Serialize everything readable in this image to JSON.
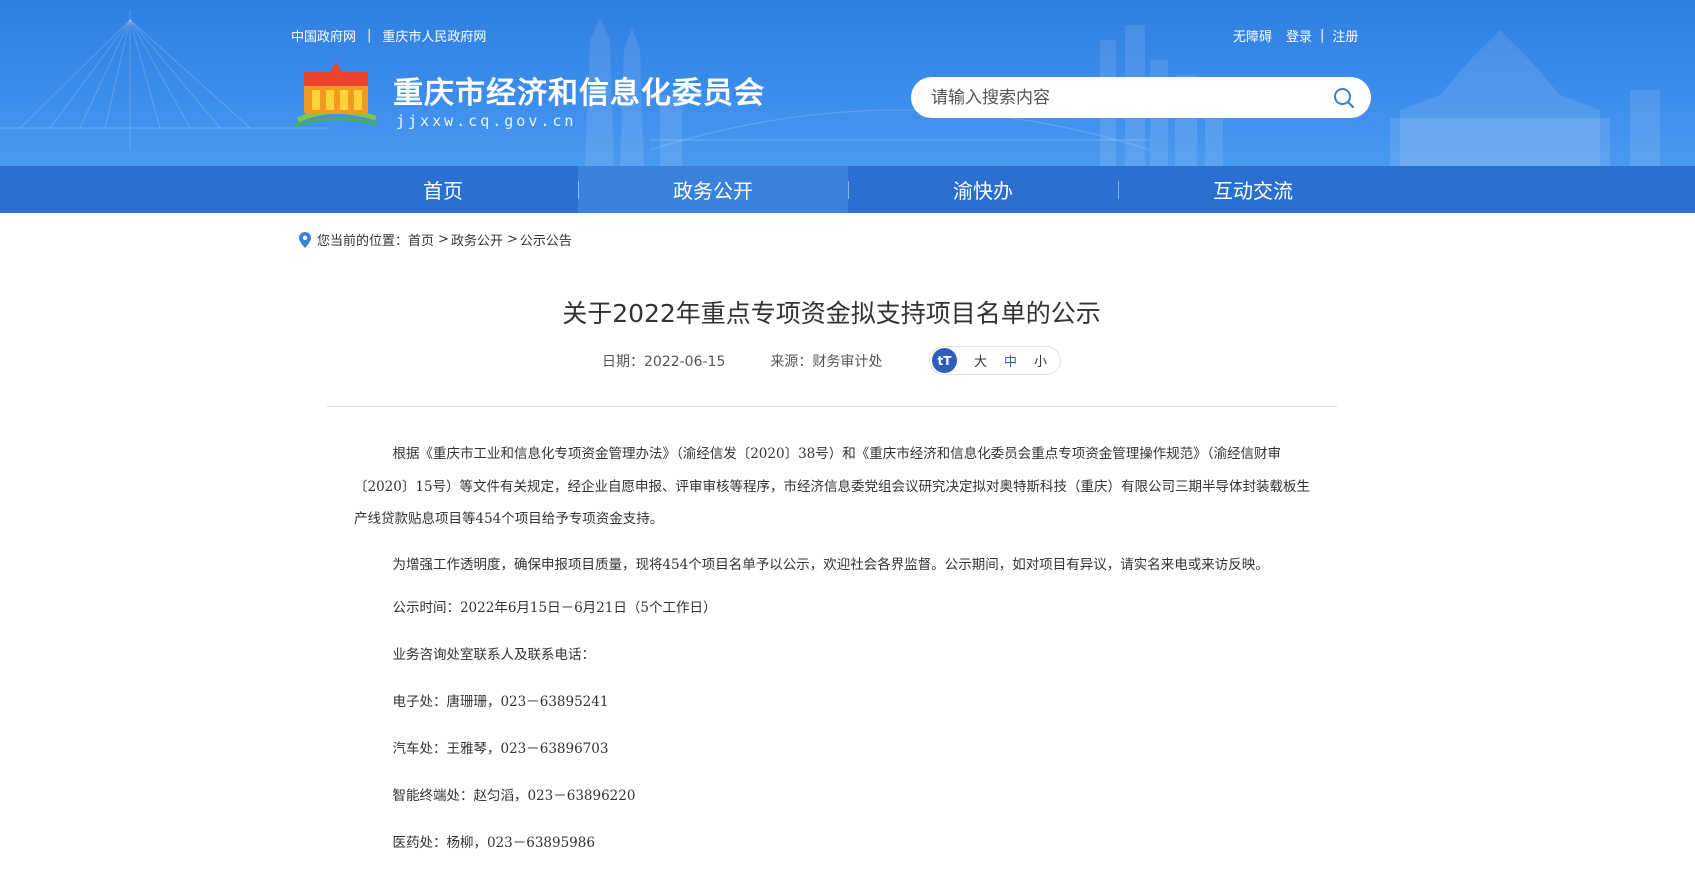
{
  "header": {
    "top_links": [
      "中国政府网",
      "重庆市人民政府网"
    ],
    "user_links": {
      "accessibility": "无障碍",
      "login": "登录",
      "register": "注册"
    },
    "site_title": "重庆市经济和信息化委员会",
    "site_domain": "jjxxw.cq.gov.cn",
    "search": {
      "placeholder": "请输入搜索内容"
    }
  },
  "nav": {
    "items": [
      {
        "label": "首页"
      },
      {
        "label": "政务公开"
      },
      {
        "label": "渝快办"
      },
      {
        "label": "互动交流"
      }
    ],
    "active": "政务公开"
  },
  "breadcrumb": {
    "prefix": "您当前的位置：",
    "items": [
      "首页",
      "政务公开",
      "公示公告"
    ]
  },
  "article": {
    "title": "关于2022年重点专项资金拟支持项目名单的公示",
    "date": "日期：2022-06-15",
    "source": "来源：财务审计处",
    "font_size": {
      "large": "大",
      "medium": "中",
      "small": "小",
      "active": "中"
    },
    "paragraphs": [
      "根据《重庆市工业和信息化专项资金管理办法》（渝经信发〔2020〕38号）和《重庆市经济和信息化委员会重点专项资金管理操作规范》（渝经信财审〔2020〕15号）等文件有关规定，经企业自愿申报、评审审核等程序，市经济信息委党组会议研究决定拟对奥特斯科技（重庆）有限公司三期半导体封装载板生产线贷款贴息项目等454个项目给予专项资金支持。",
      "为增强工作透明度，确保申报项目质量，现将454个项目名单予以公示，欢迎社会各界监督。公示期间，如对项目有异议，请实名来电或来访反映。",
      "公示时间：2022年6月15日－6月21日（5个工作日）",
      "业务咨询处室联系人及联系电话：",
      "电子处：唐珊珊，023－63895241",
      "汽车处：王雅琴，023－63896703",
      "智能终端处：赵匀滔，023－63896220",
      "医药处：杨柳，023－63895986"
    ]
  },
  "colors": {
    "banner": "#3b8ceb",
    "nav": "#2b6fd1",
    "nav_active": "#3a82dc",
    "accent": "#2b5fb8"
  },
  "icons": [
    "logo-emblem",
    "search-icon",
    "location-pin-icon",
    "text-size-icon"
  ]
}
